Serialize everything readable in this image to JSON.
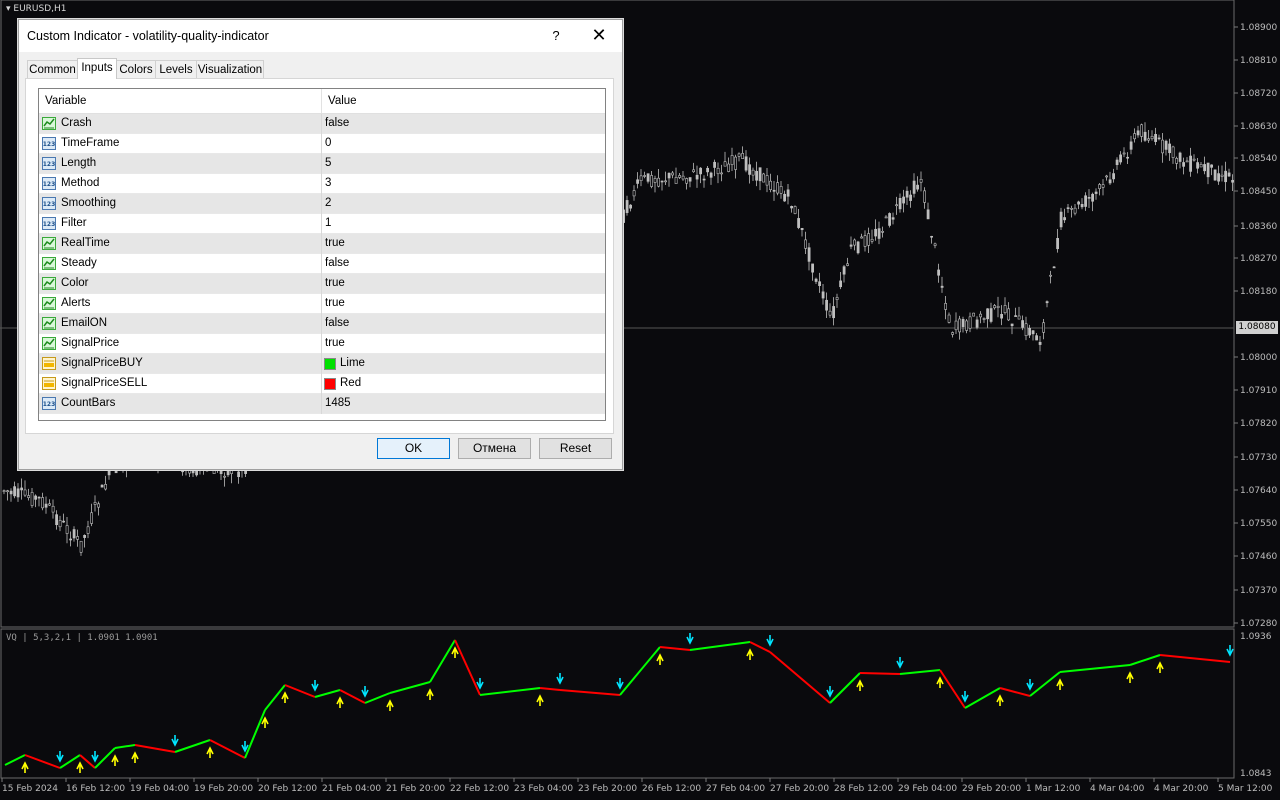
{
  "chart": {
    "symbol": "EURUSD,H1",
    "current_price": "1.08080",
    "price_axis": [
      "1.08900",
      "1.08810",
      "1.08720",
      "1.08630",
      "1.08540",
      "1.08450",
      "1.08360",
      "1.08270",
      "1.08180",
      "1.08000",
      "1.07910",
      "1.07820",
      "1.07730",
      "1.07640",
      "1.07550",
      "1.07460",
      "1.07370",
      "1.07280"
    ],
    "indicator_label": "VQ | 5,3,2,1 | 1.0901 1.0901",
    "indicator_axis": [
      "1.0936",
      "1.0843"
    ],
    "date_axis": [
      "15 Feb 2024",
      "16 Feb 12:00",
      "19 Feb 04:00",
      "19 Feb 20:00",
      "20 Feb 12:00",
      "21 Feb 04:00",
      "21 Feb 20:00",
      "22 Feb 12:00",
      "23 Feb 04:00",
      "23 Feb 20:00",
      "26 Feb 12:00",
      "27 Feb 04:00",
      "27 Feb 20:00",
      "28 Feb 12:00",
      "29 Feb 04:00",
      "29 Feb 20:00",
      "1 Mar 12:00",
      "4 Mar 04:00",
      "4 Mar 20:00",
      "5 Mar 12:00"
    ],
    "colors": {
      "background": "#0a0a0d",
      "candle": "#bfbfbf",
      "buy": "#00ff00",
      "sell": "#ff0000",
      "buy_arrow": "#ffff00",
      "sell_arrow": "#00e5ff"
    }
  },
  "dialog": {
    "title": "Custom Indicator - volatility-quality-indicator",
    "help_label": "?",
    "close_label": "✕",
    "tabs": [
      "Common",
      "Inputs",
      "Colors",
      "Levels",
      "Visualization"
    ],
    "active_tab": "Inputs",
    "columns": {
      "variable": "Variable",
      "value": "Value"
    },
    "rows": [
      {
        "name": "Crash",
        "value": "false",
        "icon": "bool-icon"
      },
      {
        "name": "TimeFrame",
        "value": "0",
        "icon": "int-icon"
      },
      {
        "name": "Length",
        "value": "5",
        "icon": "int-icon"
      },
      {
        "name": "Method",
        "value": "3",
        "icon": "int-icon"
      },
      {
        "name": "Smoothing",
        "value": "2",
        "icon": "int-icon"
      },
      {
        "name": "Filter",
        "value": "1",
        "icon": "int-icon"
      },
      {
        "name": "RealTime",
        "value": "true",
        "icon": "bool-icon"
      },
      {
        "name": "Steady",
        "value": "false",
        "icon": "bool-icon"
      },
      {
        "name": "Color",
        "value": "true",
        "icon": "bool-icon"
      },
      {
        "name": "Alerts",
        "value": "true",
        "icon": "bool-icon"
      },
      {
        "name": "EmailON",
        "value": "false",
        "icon": "bool-icon"
      },
      {
        "name": "SignalPrice",
        "value": "true",
        "icon": "bool-icon"
      },
      {
        "name": "SignalPriceBUY",
        "value": "Lime",
        "icon": "color-icon",
        "swatch": "#00e000"
      },
      {
        "name": "SignalPriceSELL",
        "value": "Red",
        "icon": "color-icon",
        "swatch": "#ff0000"
      },
      {
        "name": "CountBars",
        "value": "1485",
        "icon": "int-icon"
      }
    ],
    "buttons": {
      "ok": "OK",
      "cancel": "Отмена",
      "reset": "Reset"
    }
  }
}
